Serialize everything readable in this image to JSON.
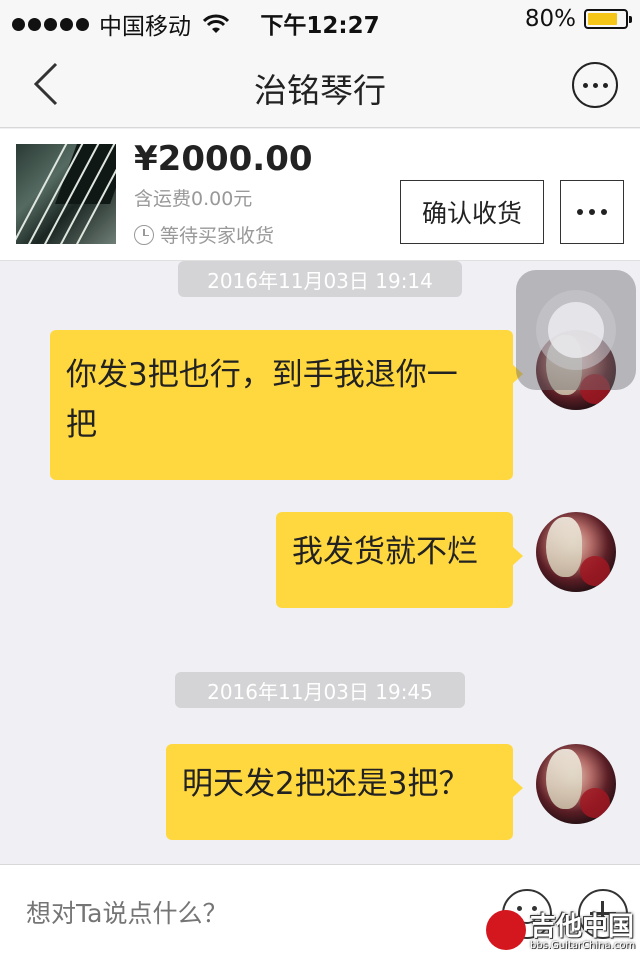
{
  "status_bar": {
    "carrier": "中国移动",
    "time": "下午12:27",
    "battery": "80%",
    "battery_level": 0.8
  },
  "nav": {
    "title": "治铭琴行",
    "back_icon": "chevron-left-icon",
    "more_icon": "more-circle-icon"
  },
  "item": {
    "price": "¥2000.00",
    "shipping": "含运费0.00元",
    "status": "等待买家收货",
    "confirm_label": "确认收货"
  },
  "messages": [
    {
      "timestamp": "2016年11月03日 19:14",
      "text_lines": [
        "你发3把也行，到手我退你一",
        "把"
      ]
    },
    {
      "text_lines": [
        "我发货就不烂"
      ]
    },
    {
      "timestamp": "2016年11月03日 19:45",
      "text_lines": [
        "明天发2把还是3把？"
      ]
    }
  ],
  "input": {
    "placeholder": "想对Ta说点什么？"
  },
  "watermark": {
    "text": "吉他中国",
    "url": "bbs.GuitarChina.com"
  },
  "colors": {
    "bubble": "#ffd83f",
    "background": "#efeff4",
    "timestamp_bg": "#d4d4d6"
  }
}
